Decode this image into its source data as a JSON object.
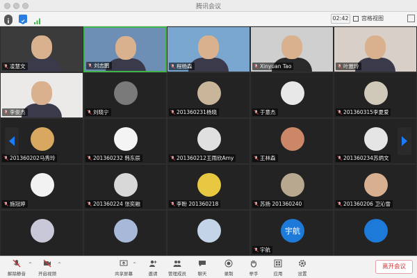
{
  "window": {
    "title": "腾讯会议"
  },
  "topbar": {
    "timer": "02:42",
    "view_label": "宫格视图"
  },
  "tiles": [
    {
      "name": "凌慧文",
      "kind": "video"
    },
    {
      "name": "刘志鹏",
      "kind": "video"
    },
    {
      "name": "程杨森",
      "kind": "video"
    },
    {
      "name": "Xinyuan Tao",
      "kind": "video"
    },
    {
      "name": "叶雅玲",
      "kind": "video"
    },
    {
      "name": "李俊杰",
      "kind": "video"
    },
    {
      "name": "刘晓宁",
      "kind": "avatar"
    },
    {
      "name": "201360231杨晓",
      "kind": "avatar"
    },
    {
      "name": "于意杰",
      "kind": "avatar"
    },
    {
      "name": "201360315李夏爱",
      "kind": "avatar"
    },
    {
      "name": "201360202马秀玲",
      "kind": "avatar"
    },
    {
      "name": "201360232 韩东辰",
      "kind": "avatar"
    },
    {
      "name": "201360212王雨欣Amy",
      "kind": "avatar"
    },
    {
      "name": "王林森",
      "kind": "avatar"
    },
    {
      "name": "201360234苏炳文",
      "kind": "avatar"
    },
    {
      "name": "施冠婷",
      "kind": "avatar"
    },
    {
      "name": "201360224 张奕融",
      "kind": "avatar"
    },
    {
      "name": "李盼 201360218",
      "kind": "avatar"
    },
    {
      "name": "苏扬 201360240",
      "kind": "avatar"
    },
    {
      "name": "201360206 卫沁雪",
      "kind": "avatar"
    },
    {
      "name": "",
      "kind": "avatar"
    },
    {
      "name": "",
      "kind": "avatar"
    },
    {
      "name": "",
      "kind": "avatar"
    },
    {
      "name": "宇航",
      "kind": "avatar"
    },
    {
      "name": "",
      "kind": "avatar"
    }
  ],
  "bottombar": {
    "mute": "解除静音",
    "video": "开启视频",
    "share": "共享屏幕",
    "invite": "邀请",
    "manage": "管理成员",
    "chat": "聊天",
    "record": "录制",
    "raise": "举手",
    "apps": "应用",
    "settings": "设置",
    "leave": "离开会议"
  },
  "avatar_badge_text": "宇航",
  "colors": {
    "active_border": "#3fb54a",
    "leave_text": "#d83030",
    "arrow_blue": "#1a7cff"
  }
}
